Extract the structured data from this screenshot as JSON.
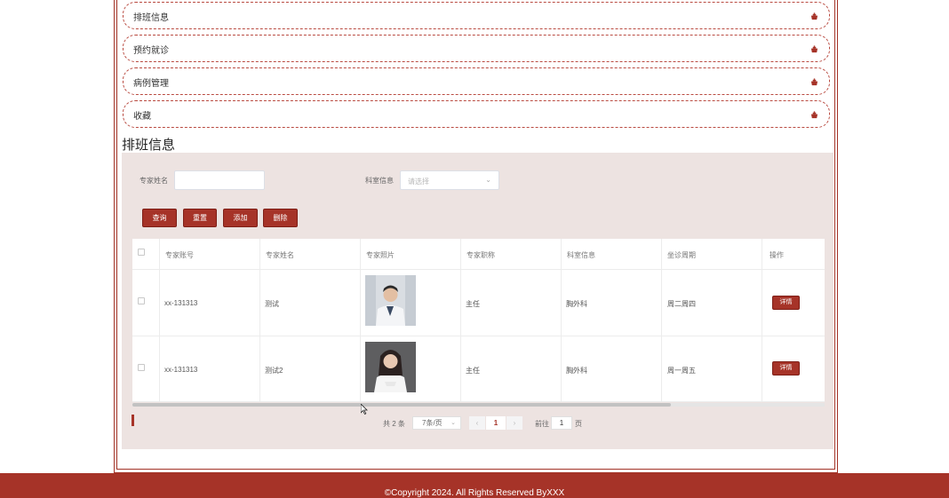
{
  "menu": [
    {
      "label": "排班信息"
    },
    {
      "label": "预约就诊"
    },
    {
      "label": "病例管理"
    },
    {
      "label": "收藏"
    }
  ],
  "section_title": "排班信息",
  "search": {
    "name_label": "专家姓名",
    "name_value": "",
    "dept_label": "科室信息",
    "dept_placeholder": "请选择"
  },
  "buttons": {
    "query": "查询",
    "reset": "重置",
    "add": "添加",
    "delete": "删除"
  },
  "table": {
    "headers": [
      "专家账号",
      "专家姓名",
      "专家照片",
      "专家职称",
      "科室信息",
      "坐诊周期",
      "操作"
    ],
    "rows": [
      {
        "account": "xx-131313",
        "name": "测试",
        "title": "主任",
        "dept": "胸外科",
        "period": "周二周四",
        "action": "详情"
      },
      {
        "account": "xx-131313",
        "name": "测试2",
        "title": "主任",
        "dept": "胸外科",
        "period": "周一周五",
        "action": "详情"
      }
    ]
  },
  "pagination": {
    "total": "共 2 条",
    "page_size": "7条/页",
    "prev": "‹",
    "current_page": "1",
    "next": "›",
    "goto_label": "前往",
    "goto_value": "1",
    "page_suffix": "页"
  },
  "footer": {
    "copyright": "©Copyright 2024. All Rights Reserved ByXXX"
  },
  "colors": {
    "accent": "#a63328",
    "panel": "#ede3e1"
  }
}
